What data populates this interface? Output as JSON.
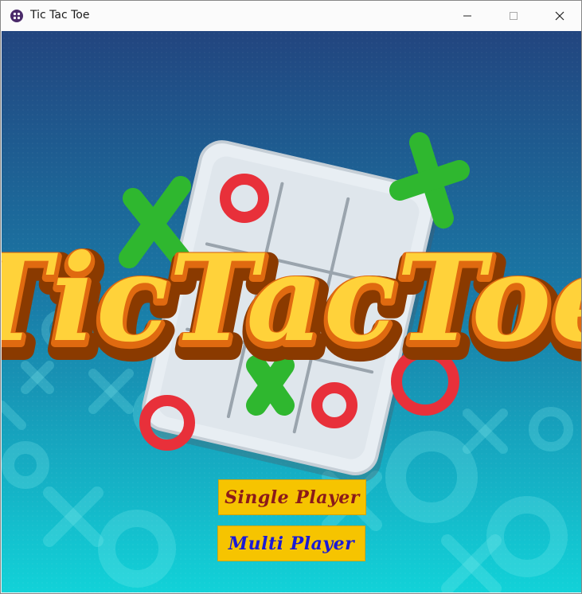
{
  "window": {
    "title": "Tic Tac Toe"
  },
  "logo": {
    "text": "TicTacToe",
    "word1": "Tic",
    "word2": "Tac",
    "word3": "Toe"
  },
  "menu": {
    "single_player": {
      "label": "Single Player",
      "color": "#8b1a1a"
    },
    "multi_player": {
      "label": "Multi Player",
      "color": "#1a1ad6"
    },
    "button_color": "#f6c400"
  },
  "colors": {
    "bg_top": "#22457f",
    "bg_bottom": "#12d2d8",
    "x_green": "#2fb72f",
    "o_red": "#e8303a",
    "logo_orange": "#f0a010"
  }
}
